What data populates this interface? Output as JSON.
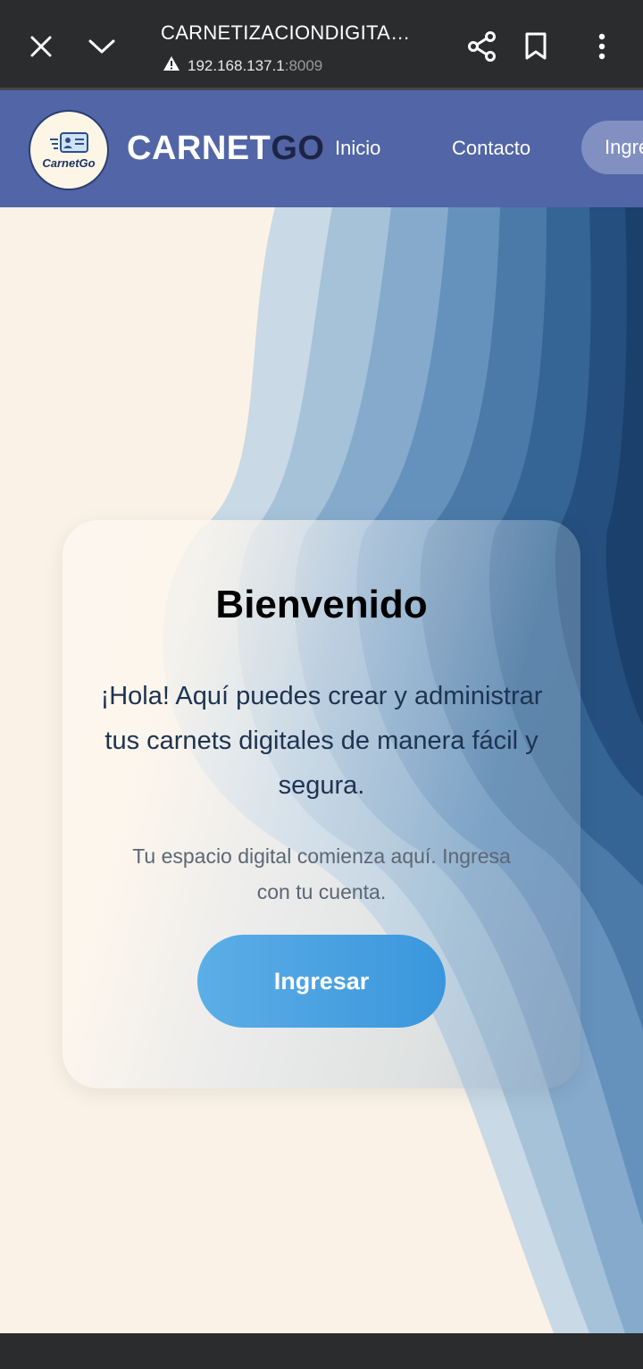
{
  "browser": {
    "title": "CARNETIZACIONDIGITA…",
    "url_host": "192.168.137.1",
    "url_port": ":8009",
    "icons": [
      "close-icon",
      "chevron-down-icon",
      "warning-icon",
      "share-icon",
      "bookmark-icon",
      "more-vert-icon"
    ]
  },
  "nav": {
    "logo_text": "CarnetGo",
    "brand_part1": "CARNET",
    "brand_part2": "GO",
    "links": [
      "Inicio",
      "Contacto"
    ],
    "login_button": "Ingresar"
  },
  "hero": {
    "title": "Bienvenido",
    "text": "¡Hola! Aquí puedes crear y administrar tus carnets digitales de manera fácil y segura.",
    "subtext": "Tu espacio digital comienza aquí. Ingresa con tu cuenta.",
    "cta_label": "Ingresar"
  },
  "colors": {
    "nav_bg": "#5265a6",
    "hero_bg": "#fbf2e7",
    "button": "#4aa3e3",
    "browser_bar": "#2b2c2e"
  }
}
